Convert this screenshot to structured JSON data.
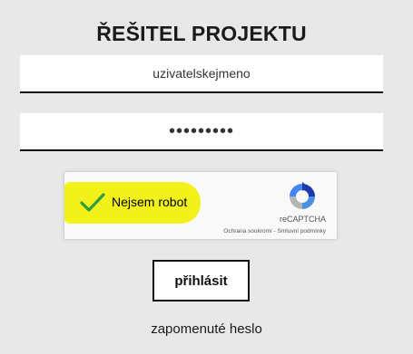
{
  "form": {
    "title": "ŘEŠITEL PROJEKTU",
    "username_value": "uzivatelskejmeno",
    "password_value": "•••••••••",
    "login_label": "přihlásit",
    "forgot_label": "zapomenuté heslo"
  },
  "captcha": {
    "label": "Nejsem robot",
    "checked": true,
    "brand": "reCAPTCHA",
    "privacy_label": "Ochrana soukromí",
    "separator": " - ",
    "terms_label": "Smluvní podmínky",
    "icons": {
      "check": "check-icon",
      "logo": "recaptcha-logo-icon"
    }
  },
  "colors": {
    "background": "#e8e8e8",
    "highlight": "#f2f21a",
    "check": "#2e9e3e",
    "text": "#111111"
  }
}
